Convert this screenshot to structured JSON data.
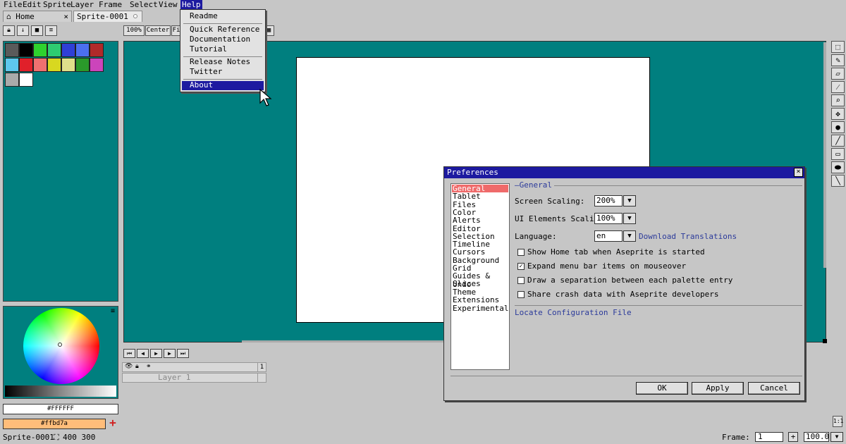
{
  "menubar": {
    "items": [
      "File",
      "Edit",
      "Sprite",
      "Layer",
      "Frame",
      "Select",
      "View",
      "Help"
    ]
  },
  "tabs": {
    "home": "Home",
    "home_close": "×",
    "sprite": "Sprite-0001"
  },
  "toolbar": {
    "zoom": "100%",
    "center": "Center",
    "fit": "Fi"
  },
  "palette": {
    "colors": [
      "#5a5a5a",
      "#000000",
      "#2ed22e",
      "#2ecc71",
      "#2f3fd6",
      "#4b6ff0",
      "#b02a2a",
      "#5ec8ee",
      "#e0202a",
      "#ef7070",
      "#d8d820",
      "#e0e08a",
      "#2a9a2a",
      "#cc44bb",
      "#aaaaaa",
      "#ffffff"
    ]
  },
  "colors": {
    "foreground_hex": "#FFFFFF",
    "background_hex": "#ffbd7a",
    "foreground": "#ffffff",
    "background": "#ffbd7a",
    "add": "+"
  },
  "help_menu": {
    "items": [
      "Readme",
      "Quick Reference",
      "Documentation",
      "Tutorial",
      "Release Notes",
      "Twitter",
      "About"
    ],
    "selected": "About"
  },
  "preferences": {
    "title": "Preferences",
    "close": "×",
    "sections": [
      "General",
      "Tablet",
      "Files",
      "Color",
      "Alerts",
      "Editor",
      "Selection",
      "Timeline",
      "Cursors",
      "Background",
      "Grid",
      "Guides & Slices",
      "Undo",
      "Theme",
      "Extensions",
      "Experimental"
    ],
    "selected_section": "General",
    "group_label": "General",
    "screen_scaling_label": "Screen Scaling:",
    "screen_scaling_value": "200%",
    "ui_scaling_label": "UI Elements Scaling:",
    "ui_scaling_value": "100%",
    "language_label": "Language:",
    "language_value": "en",
    "download_translations": "Download Translations",
    "checkboxes": [
      {
        "label": "Show Home tab when Aseprite is started",
        "checked": false
      },
      {
        "label": "Expand menu bar items on mouseover",
        "checked": true
      },
      {
        "label": "Draw a separation between each palette entry",
        "checked": false
      },
      {
        "label": "Share crash data with Aseprite developers",
        "checked": false
      }
    ],
    "locate_config": "Locate Configuration File",
    "ok": "OK",
    "apply": "Apply",
    "cancel": "Cancel"
  },
  "timeline": {
    "layer_name": "Layer 1",
    "frame_number": "1"
  },
  "statusbar": {
    "sprite_name": "Sprite-0001",
    "dimensions": "400 300",
    "frame_label": "Frame:",
    "frame_value": "1",
    "add": "+",
    "zoom_value": "100.0"
  }
}
